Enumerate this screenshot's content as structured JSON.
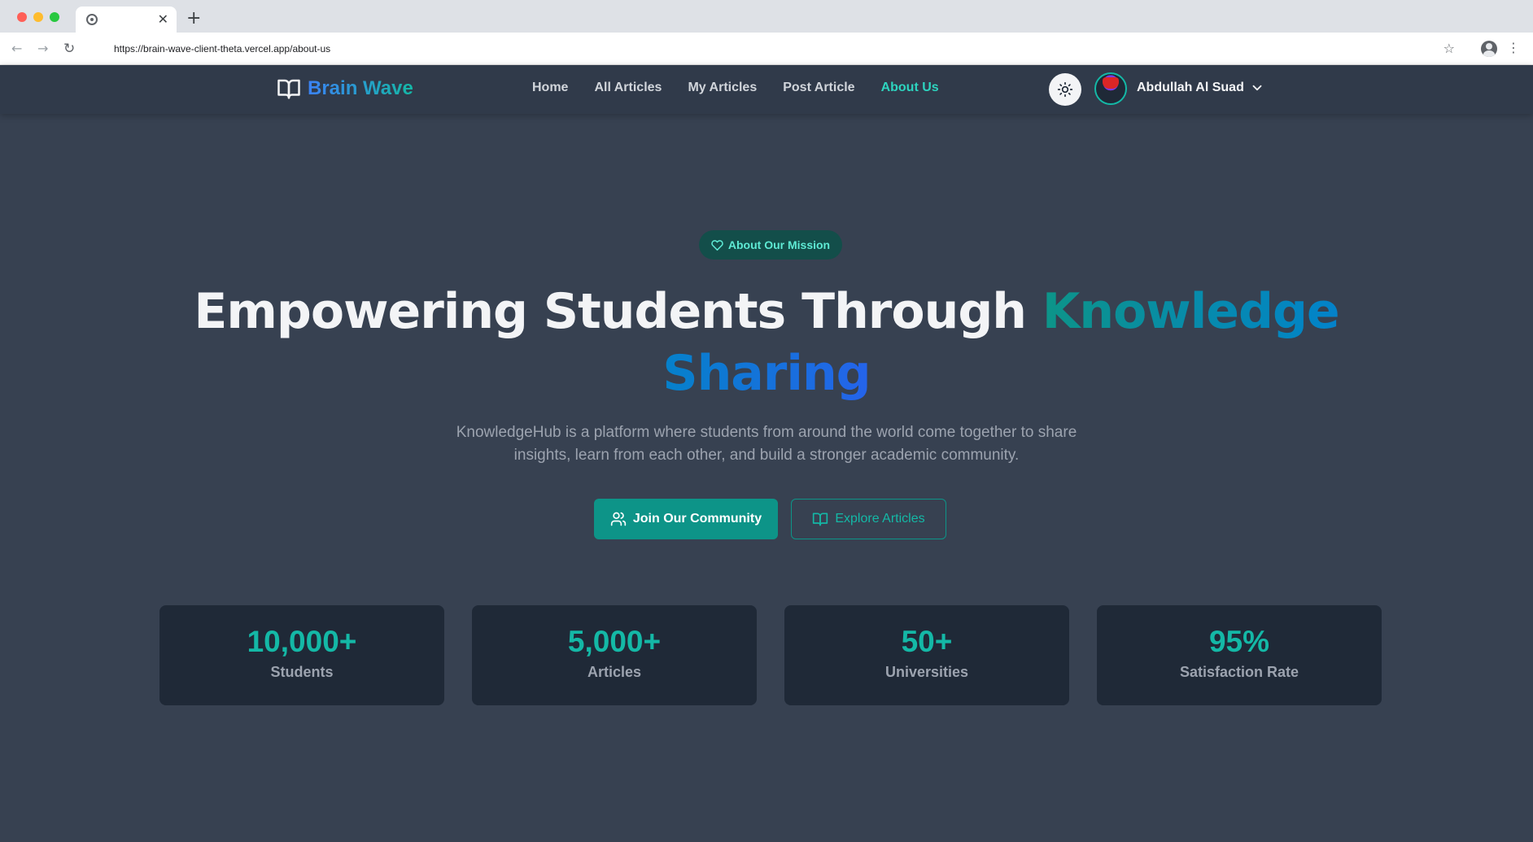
{
  "browser": {
    "url": "https://brain-wave-client-theta.vercel.app/about-us",
    "tab_close": "✕",
    "new_tab": "+"
  },
  "nav": {
    "logo_text": "Brain Wave",
    "links": [
      "Home",
      "All Articles",
      "My Articles",
      "Post Article",
      "About Us"
    ],
    "active_link": "About Us",
    "username": "Abdullah Al Suad"
  },
  "hero": {
    "badge": "About Our Mission",
    "title_plain": "Empowering Students Through ",
    "title_highlight": "Knowledge Sharing",
    "description": "KnowledgeHub is a platform where students from around the world come together to share insights, learn from each other, and build a stronger academic community.",
    "primary_button": "Join Our Community",
    "secondary_button": "Explore Articles"
  },
  "stats": [
    {
      "value": "10,000+",
      "label": "Students"
    },
    {
      "value": "5,000+",
      "label": "Articles"
    },
    {
      "value": "50+",
      "label": "Universities"
    },
    {
      "value": "95%",
      "label": "Satisfaction Rate"
    }
  ],
  "colors": {
    "accent": "#14b8a6",
    "page_bg": "#374151",
    "card_bg": "#1f2937",
    "nav_bg": "#303a4a"
  },
  "icons": [
    "book-open-icon",
    "sun-icon",
    "chevron-down-icon",
    "heart-icon",
    "users-icon",
    "book-icon"
  ]
}
